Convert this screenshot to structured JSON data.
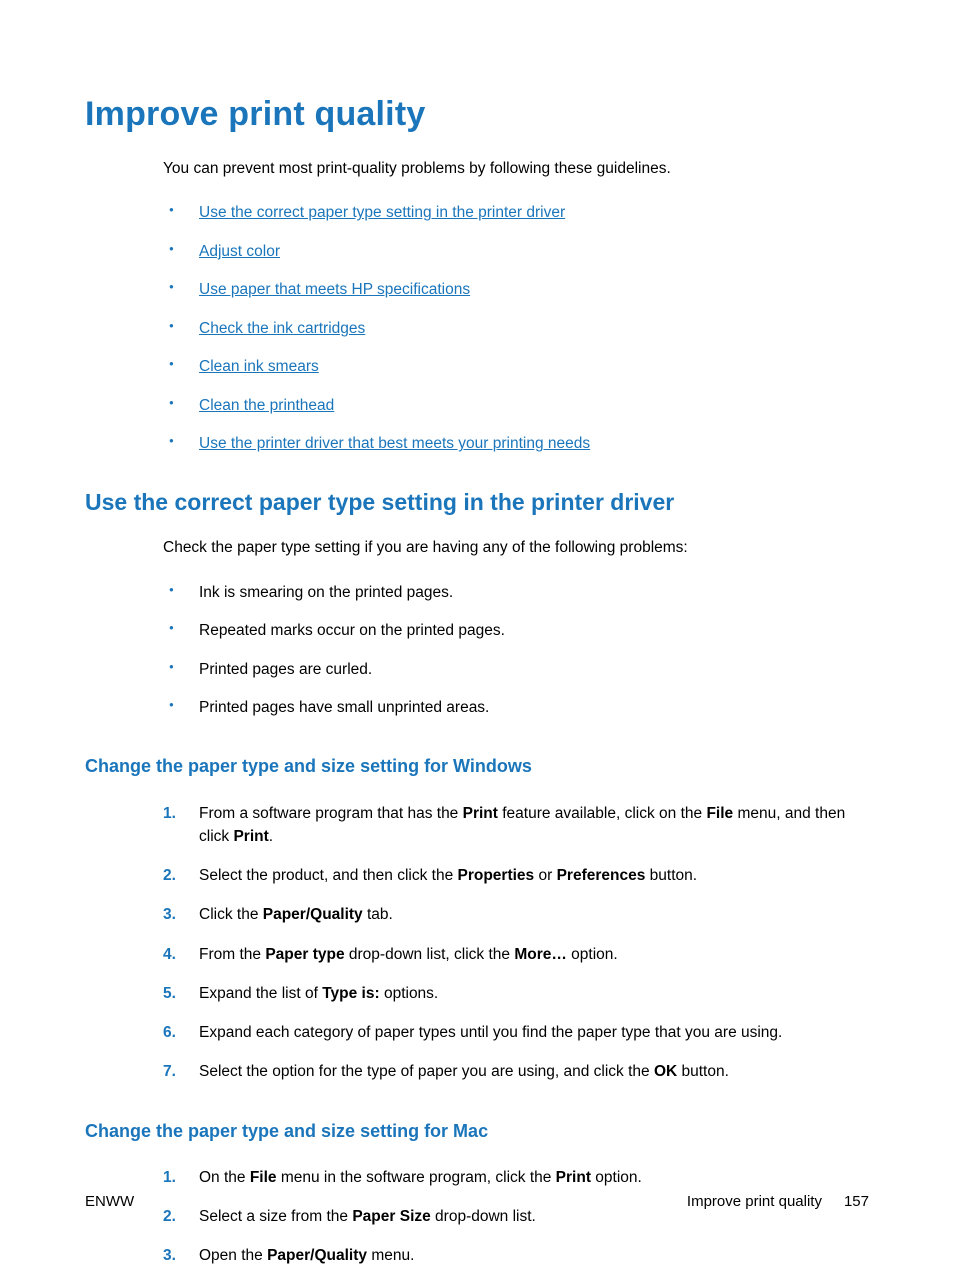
{
  "title": "Improve print quality",
  "intro": "You can prevent most print-quality problems by following these guidelines.",
  "toc": [
    "Use the correct paper type setting in the printer driver",
    "Adjust color",
    "Use paper that meets HP specifications",
    "Check the ink cartridges",
    "Clean ink smears",
    "Clean the printhead",
    "Use the printer driver that best meets your printing needs"
  ],
  "section1": {
    "heading": "Use the correct paper type setting in the printer driver",
    "intro": "Check the paper type setting if you are having any of the following problems:",
    "items": [
      "Ink is smearing on the printed pages.",
      "Repeated marks occur on the printed pages.",
      "Printed pages are curled.",
      "Printed pages have small unprinted areas."
    ]
  },
  "sub_win": {
    "heading": "Change the paper type and size setting for Windows",
    "steps": [
      {
        "pre": "From a software program that has the ",
        "b1": "Print",
        "mid1": " feature available, click on the ",
        "b2": "File",
        "mid2": " menu, and then click ",
        "b3": "Print",
        "post": "."
      },
      {
        "pre": "Select the product, and then click the ",
        "b1": "Properties",
        "mid1": " or ",
        "b2": "Preferences",
        "mid2": " button.",
        "b3": "",
        "post": ""
      },
      {
        "pre": "Click the ",
        "b1": "Paper/Quality",
        "mid1": " tab.",
        "b2": "",
        "mid2": "",
        "b3": "",
        "post": ""
      },
      {
        "pre": "From the ",
        "b1": "Paper type",
        "mid1": " drop-down list, click the ",
        "b2": "More…",
        "mid2": " option.",
        "b3": "",
        "post": ""
      },
      {
        "pre": "Expand the list of ",
        "b1": "Type is:",
        "mid1": " options.",
        "b2": "",
        "mid2": "",
        "b3": "",
        "post": ""
      },
      {
        "pre": "Expand each category of paper types until you find the paper type that you are using.",
        "b1": "",
        "mid1": "",
        "b2": "",
        "mid2": "",
        "b3": "",
        "post": ""
      },
      {
        "pre": "Select the option for the type of paper you are using, and click the ",
        "b1": "OK",
        "mid1": " button.",
        "b2": "",
        "mid2": "",
        "b3": "",
        "post": ""
      }
    ]
  },
  "sub_mac": {
    "heading": "Change the paper type and size setting for Mac",
    "steps": [
      {
        "pre": "On the ",
        "b1": "File",
        "mid1": " menu in the software program, click the ",
        "b2": "Print",
        "mid2": " option.",
        "b3": "",
        "post": ""
      },
      {
        "pre": "Select a size from the ",
        "b1": "Paper Size",
        "mid1": " drop-down list.",
        "b2": "",
        "mid2": "",
        "b3": "",
        "post": ""
      },
      {
        "pre": "Open the ",
        "b1": "Paper/Quality",
        "mid1": " menu.",
        "b2": "",
        "mid2": "",
        "b3": "",
        "post": ""
      }
    ]
  },
  "footer": {
    "left": "ENWW",
    "right_text": "Improve print quality",
    "page": "157"
  }
}
